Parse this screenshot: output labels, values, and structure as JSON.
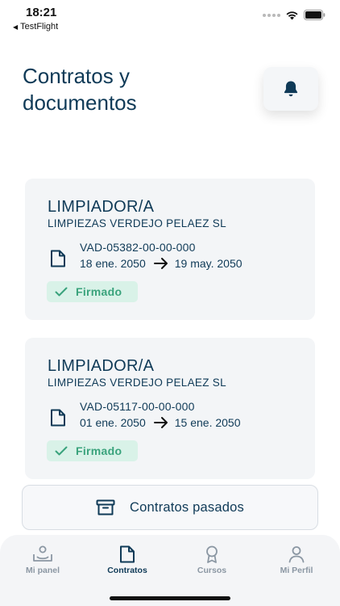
{
  "status_bar": {
    "time": "18:21",
    "back_app": "TestFlight"
  },
  "header": {
    "title": "Contratos y documentos"
  },
  "contracts": [
    {
      "role": "LIMPIADOR/A",
      "company": "LIMPIEZAS VERDEJO PELAEZ SL",
      "code": "VAD-05382-00-00-000",
      "start_date": "18 ene. 2050",
      "end_date": "19 may. 2050",
      "status": "Firmado"
    },
    {
      "role": "LIMPIADOR/A",
      "company": "LIMPIEZAS VERDEJO PELAEZ SL",
      "code": "VAD-05117-00-00-000",
      "start_date": "01 ene. 2050",
      "end_date": "15 ene. 2050",
      "status": "Firmado"
    }
  ],
  "past_contracts_button": {
    "label": "Contratos pasados"
  },
  "tabbar": {
    "items": [
      {
        "label": "Mi panel",
        "icon": "panel-icon",
        "active": false
      },
      {
        "label": "Contratos",
        "icon": "document-icon",
        "active": true
      },
      {
        "label": "Cursos",
        "icon": "award-icon",
        "active": false
      },
      {
        "label": "Mi Perfil",
        "icon": "user-icon",
        "active": false
      }
    ]
  },
  "colors": {
    "primary": "#0f3a57",
    "success_text": "#3aa37c",
    "success_bg": "#d9f2e8",
    "card_bg": "#f3f5f7",
    "tab_inactive": "#8b97a3"
  }
}
